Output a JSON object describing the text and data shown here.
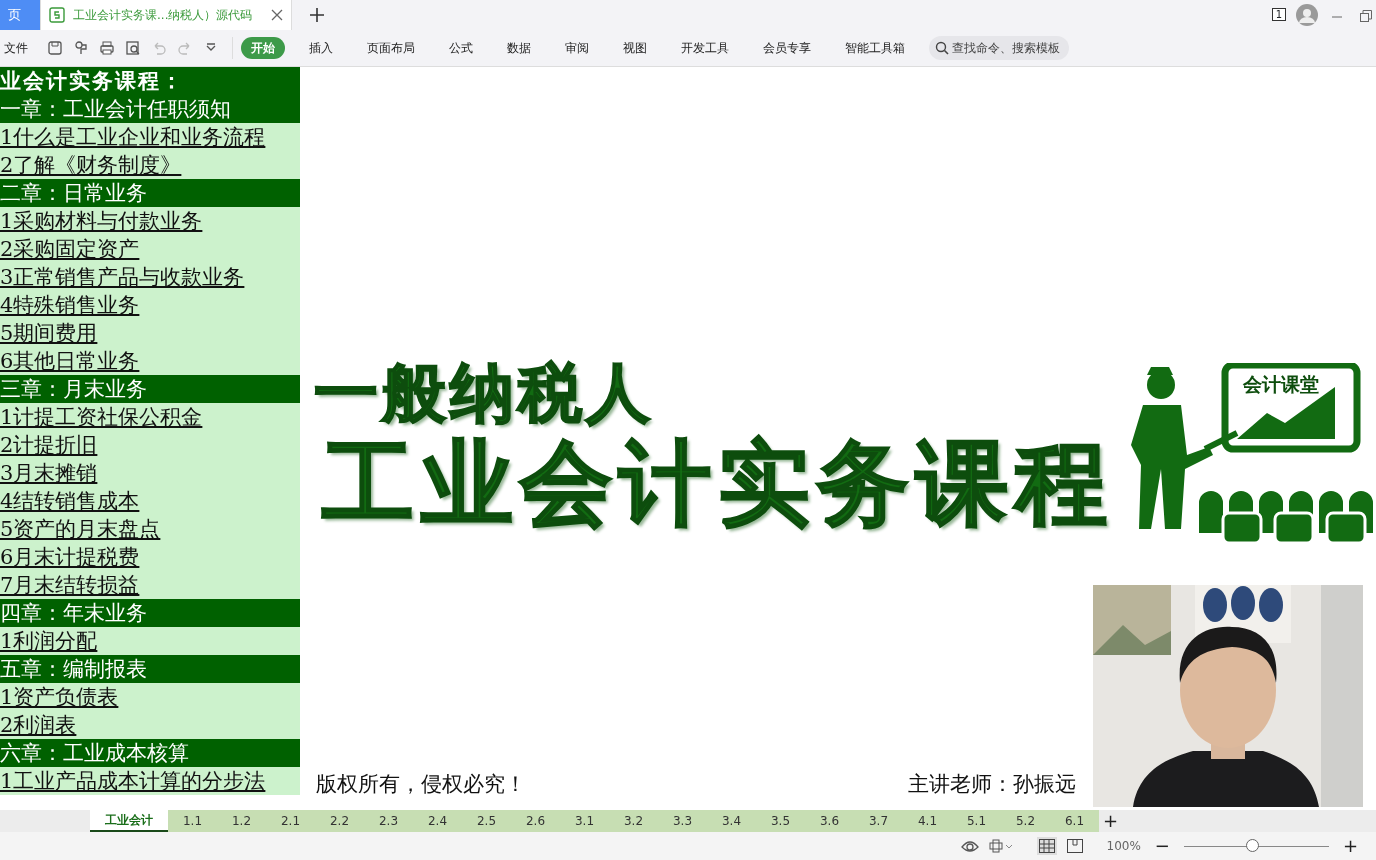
{
  "app_tabs": [
    {
      "label": "页",
      "kind": "home",
      "selected": false
    },
    {
      "label": "工业会计实务课...纳税人）源代码",
      "kind": "doc",
      "selected": true
    }
  ],
  "tab_badge": "1",
  "file_menu": "文件",
  "ribbon_tabs": [
    {
      "label": "开始",
      "selected": true
    },
    {
      "label": "插入",
      "selected": false
    },
    {
      "label": "页面布局",
      "selected": false
    },
    {
      "label": "公式",
      "selected": false
    },
    {
      "label": "数据",
      "selected": false
    },
    {
      "label": "审阅",
      "selected": false
    },
    {
      "label": "视图",
      "selected": false
    },
    {
      "label": "开发工具",
      "selected": false
    },
    {
      "label": "会员专享",
      "selected": false
    },
    {
      "label": "智能工具箱",
      "selected": false
    }
  ],
  "search": {
    "placeholder": "查找命令、搜索模板"
  },
  "outline": [
    {
      "text": "业会计实务课程：",
      "kind": "title"
    },
    {
      "text": "一章：工业会计任职须知",
      "kind": "chapter"
    },
    {
      "text": "1什么是工业企业和业务流程",
      "kind": "lesson"
    },
    {
      "text": "2了解《财务制度》",
      "kind": "lesson"
    },
    {
      "text": "二章：日常业务",
      "kind": "chapter"
    },
    {
      "text": "1采购材料与付款业务",
      "kind": "lesson"
    },
    {
      "text": "2采购固定资产",
      "kind": "lesson"
    },
    {
      "text": "3正常销售产品与收款业务",
      "kind": "lesson"
    },
    {
      "text": "4特殊销售业务",
      "kind": "lesson"
    },
    {
      "text": "5期间费用",
      "kind": "lesson"
    },
    {
      "text": "6其他日常业务",
      "kind": "lesson"
    },
    {
      "text": "三章：月末业务",
      "kind": "chapter"
    },
    {
      "text": "1计提工资社保公积金",
      "kind": "lesson"
    },
    {
      "text": "2计提折旧",
      "kind": "lesson"
    },
    {
      "text": "3月末摊销",
      "kind": "lesson"
    },
    {
      "text": "4结转销售成本",
      "kind": "lesson"
    },
    {
      "text": "5资产的月末盘点",
      "kind": "lesson"
    },
    {
      "text": "6月末计提税费",
      "kind": "lesson"
    },
    {
      "text": "7月末结转损益",
      "kind": "lesson"
    },
    {
      "text": "四章：年末业务",
      "kind": "chapter"
    },
    {
      "text": "1利润分配",
      "kind": "lesson"
    },
    {
      "text": "五章：编制报表",
      "kind": "chapter"
    },
    {
      "text": "1资产负债表",
      "kind": "lesson"
    },
    {
      "text": "2利润表",
      "kind": "lesson"
    },
    {
      "text": "六章：工业成本核算",
      "kind": "chapter"
    },
    {
      "text": "1工业产品成本计算的分步法",
      "kind": "lesson"
    }
  ],
  "banner": {
    "subtitle": "一般纳税人",
    "title": "工业会计实务课程",
    "board_text": "会计课堂",
    "copyright": "版权所有，侵权必究！",
    "lecturer": "主讲老师：孙振远"
  },
  "sheet_tabs": [
    {
      "label": "工业会计",
      "selected": true
    },
    {
      "label": "1.1",
      "selected": false
    },
    {
      "label": "1.2",
      "selected": false
    },
    {
      "label": "2.1",
      "selected": false
    },
    {
      "label": "2.2",
      "selected": false
    },
    {
      "label": "2.3",
      "selected": false
    },
    {
      "label": "2.4",
      "selected": false
    },
    {
      "label": "2.5",
      "selected": false
    },
    {
      "label": "2.6",
      "selected": false
    },
    {
      "label": "3.1",
      "selected": false
    },
    {
      "label": "3.2",
      "selected": false
    },
    {
      "label": "3.3",
      "selected": false
    },
    {
      "label": "3.4",
      "selected": false
    },
    {
      "label": "3.5",
      "selected": false
    },
    {
      "label": "3.6",
      "selected": false
    },
    {
      "label": "3.7",
      "selected": false
    },
    {
      "label": "4.1",
      "selected": false
    },
    {
      "label": "5.1",
      "selected": false
    },
    {
      "label": "5.2",
      "selected": false
    },
    {
      "label": "6.1",
      "selected": false
    }
  ],
  "add_sheet": "+",
  "status": {
    "zoom": "100%",
    "level": 0.47,
    "zoom_out": "−",
    "zoom_in": "+"
  }
}
